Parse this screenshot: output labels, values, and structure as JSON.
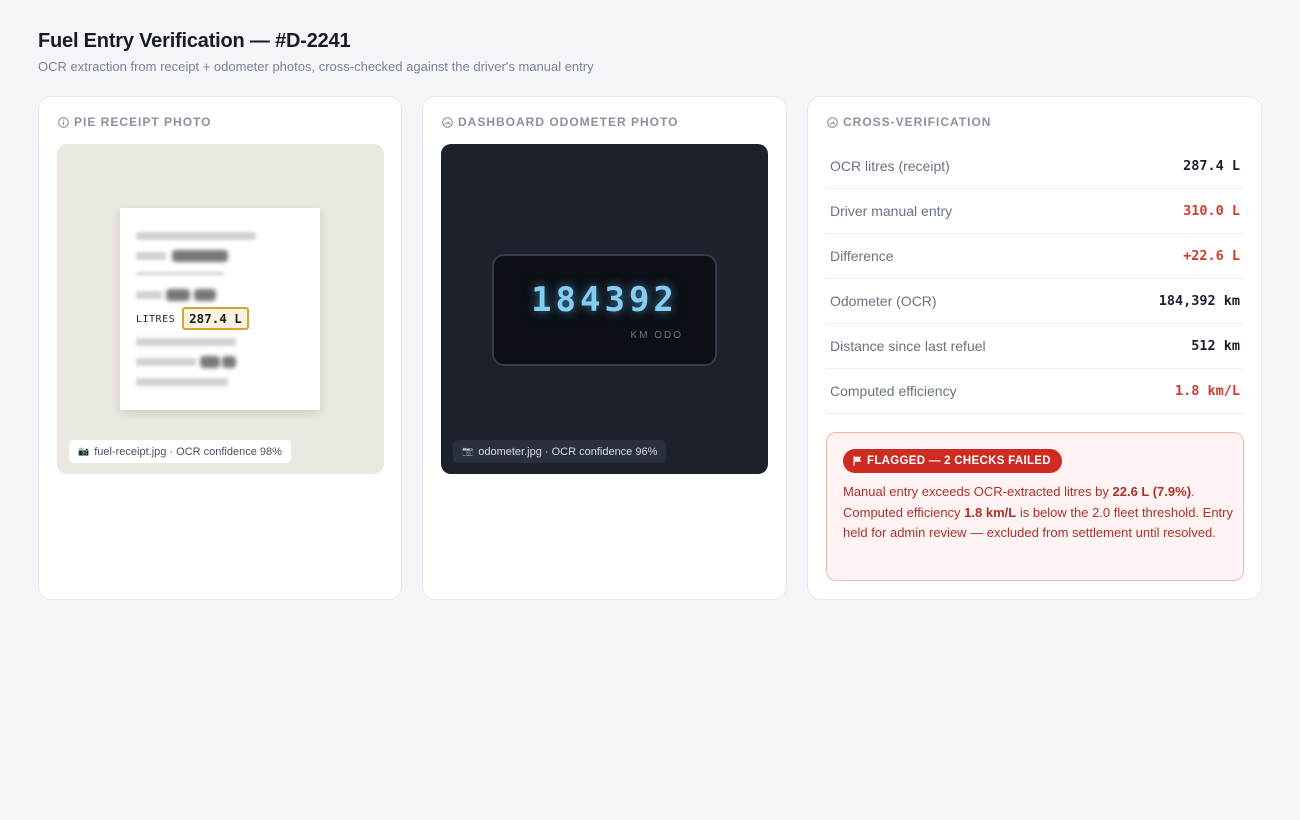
{
  "page": {
    "title": "Fuel Entry Verification — #D-2241",
    "subtitle": "OCR extraction from receipt + odometer photos, cross-checked against the driver's manual entry"
  },
  "receipt": {
    "card_title": "PIE RECEIPT PHOTO",
    "icon": "info-icon",
    "litres_label": "LITRES",
    "litres_value": "287.4 L",
    "caption": "fuel-receipt.jpg · OCR confidence 98%",
    "caption_icon": "camera-icon"
  },
  "odometer": {
    "card_title": "DASHBOARD ODOMETER PHOTO",
    "icon": "gauge-icon",
    "reading": "184392",
    "unit": "KM ODO",
    "caption": "odometer.jpg · OCR confidence 96%",
    "caption_icon": "camera-icon"
  },
  "verification": {
    "card_title": "CROSS-VERIFICATION",
    "icon": "gauge-icon",
    "rows": [
      {
        "label": "OCR litres (receipt)",
        "value": "287.4 L",
        "status": "normal"
      },
      {
        "label": "Driver manual entry",
        "value": "310.0 L",
        "status": "error"
      },
      {
        "label": "Difference",
        "value": "+22.6 L",
        "status": "error"
      },
      {
        "label": "Odometer (OCR)",
        "value": "184,392 km",
        "status": "normal"
      },
      {
        "label": "Distance since last refuel",
        "value": "512 km",
        "status": "normal"
      },
      {
        "label": "Computed efficiency",
        "value": "1.8 km/L",
        "status": "error"
      }
    ],
    "alert": {
      "badge": "FLAGGED — 2 CHECKS FAILED",
      "icon": "flag-icon",
      "text_1": "Manual entry exceeds OCR-extracted litres by ",
      "highlight_1": "22.6 L (7.9%)",
      "text_2": ". Computed efficiency ",
      "highlight_2": "1.8 km/L",
      "text_3": " is below the 2.0 fleet threshold. Entry held for admin review — excluded from settlement until resolved."
    }
  },
  "colors": {
    "error": "#d23a2f",
    "normal": "#1b2030",
    "highlight_border": "#d4a534",
    "odometer_digits": "#86cdf3"
  }
}
